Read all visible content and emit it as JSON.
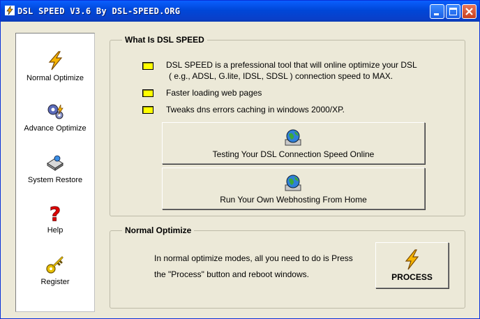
{
  "window": {
    "title": "DSL SPEED V3.6 By DSL-SPEED.ORG"
  },
  "sidebar": {
    "items": [
      {
        "label": "Normal Optimize"
      },
      {
        "label": "Advance Optimize"
      },
      {
        "label": "System Restore"
      },
      {
        "label": "Help"
      },
      {
        "label": "Register"
      }
    ]
  },
  "about": {
    "heading": "What Is DSL SPEED",
    "features": [
      "DSL SPEED is a prefessional tool that will online optimize your DSL",
      "( e.g., ADSL, G.lite, IDSL, SDSL ) connection speed to MAX.",
      "Faster loading web pages",
      "Tweaks dns errors caching in windows 2000/XP."
    ],
    "buttons": [
      {
        "label": "Testing Your DSL Connection Speed Online"
      },
      {
        "label": "Run Your Own Webhosting From Home"
      }
    ]
  },
  "normal": {
    "heading": "Normal Optimize",
    "desc_line1": "In normal optimize modes, all you need to do is Press",
    "desc_line2": "the \"Process\" button and reboot windows.",
    "process_label": "PROCESS"
  },
  "colors": {
    "titlebar": "#0a5ffe",
    "bullet": "#ffff00",
    "background": "#ece9d8"
  },
  "icons": [
    "lightning-icon",
    "gears-icon",
    "restore-icon",
    "help-icon",
    "key-icon",
    "globe-icon"
  ]
}
